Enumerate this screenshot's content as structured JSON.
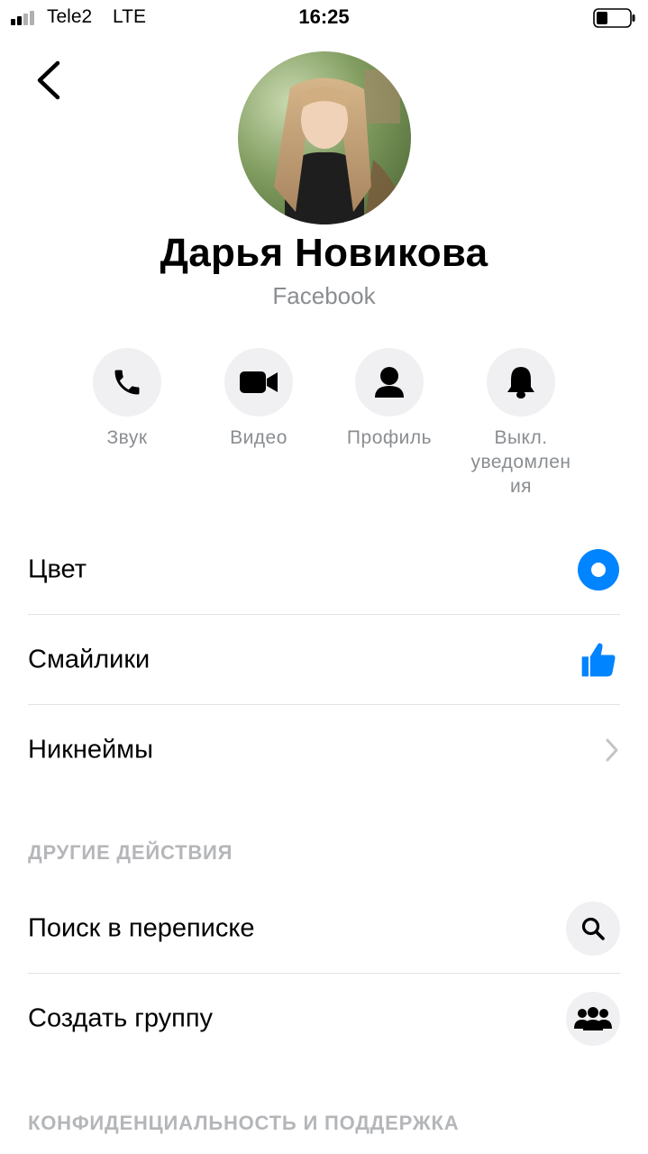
{
  "status_bar": {
    "carrier": "Tele2",
    "network": "LTE",
    "time": "16:25"
  },
  "profile": {
    "name": "Дарья Новикова",
    "subtitle": "Facebook"
  },
  "actions": [
    {
      "label": "Звук",
      "icon": "phone-icon"
    },
    {
      "label": "Видео",
      "icon": "video-camera-icon"
    },
    {
      "label": "Профиль",
      "icon": "person-icon"
    },
    {
      "label": "Выкл. уведомления",
      "label_line1": "Выкл.",
      "label_line2": "уведомлен",
      "label_line3": "ия",
      "icon": "bell-icon"
    }
  ],
  "settings": [
    {
      "label": "Цвет",
      "icon": "color-dot-icon"
    },
    {
      "label": "Смайлики",
      "icon": "thumbs-up-icon"
    },
    {
      "label": "Никнеймы",
      "icon": "chevron-right-icon"
    }
  ],
  "other_actions": {
    "title": "ДРУГИЕ ДЕЙСТВИЯ",
    "items": [
      {
        "label": "Поиск в переписке",
        "icon": "search-icon"
      },
      {
        "label": "Создать группу",
        "icon": "group-icon"
      }
    ]
  },
  "privacy": {
    "title": "КОНФИДЕНЦИАЛЬНОСТЬ И ПОДДЕРЖКА"
  },
  "colors": {
    "accent": "#0084ff",
    "label_gray": "#8a8d91",
    "section_gray": "#b4b6b9",
    "circle_bg": "#f0f0f2"
  }
}
